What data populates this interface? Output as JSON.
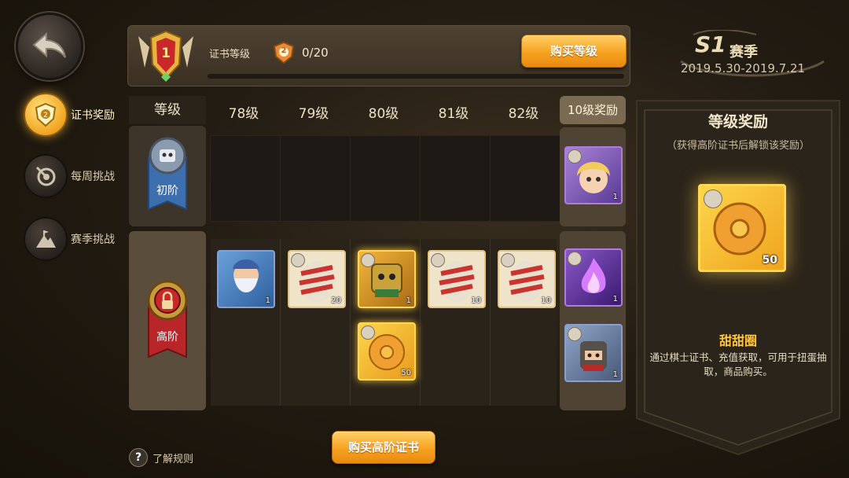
{
  "nav": {
    "items": [
      {
        "label": "证书奖励",
        "icon": "shield-cert-icon",
        "active": true
      },
      {
        "label": "每周挑战",
        "icon": "target-icon",
        "active": false
      },
      {
        "label": "赛季挑战",
        "icon": "mountain-flag-icon",
        "active": false
      }
    ]
  },
  "top": {
    "level_badge_number": "1",
    "cert_level_label": "证书等级",
    "xp_icon_number": "2",
    "xp": "0/20",
    "xp_progress": 0,
    "buy_level_label": "购买等级",
    "season_title": "S1",
    "season_suffix": "赛季",
    "season_dates": "2019.5.30-2019.7.21"
  },
  "grid": {
    "header_level": "等级",
    "levels": [
      "78级",
      "79级",
      "80级",
      "81级",
      "82级"
    ],
    "reward10_header": "10级奖励",
    "tiers": {
      "basic": "初阶",
      "advanced": "高阶"
    },
    "advanced_items": [
      {
        "col": 0,
        "icon": "dwarf-chess-piece-icon",
        "qty": "1",
        "frame": "blue"
      },
      {
        "col": 1,
        "icon": "striped-egg-icon",
        "qty": "20",
        "frame": "tan"
      },
      {
        "col": 2,
        "icon": "mech-chess-piece-icon",
        "qty": "1",
        "frame": "gold"
      },
      {
        "col": 3,
        "icon": "striped-egg-icon",
        "qty": "10",
        "frame": "tan"
      },
      {
        "col": 4,
        "icon": "striped-egg-icon",
        "qty": "10",
        "frame": "tan"
      },
      {
        "col": 2,
        "icon": "donut-icon",
        "qty": "50",
        "frame": "gold"
      }
    ],
    "reward10_basic": [
      {
        "icon": "blonde-hero-avatar-icon",
        "qty": "1",
        "frame": "purple"
      }
    ],
    "reward10_advanced": [
      {
        "icon": "purple-flame-icon",
        "qty": "1",
        "frame": "purple"
      },
      {
        "icon": "armored-knight-avatar-icon",
        "qty": "1",
        "frame": "blue"
      }
    ]
  },
  "panel": {
    "title": "等级奖励",
    "subtitle": "（获得高阶证书后解锁该奖励）",
    "item_icon": "donut-icon",
    "item_qty": "50",
    "item_name": "甜甜圈",
    "item_desc": "通过棋士证书、充值获取，可用于扭蛋抽取，商品购买。"
  },
  "footer": {
    "buy_advanced_label": "购买高阶证书",
    "help_label": "了解规则",
    "help_icon_glyph": "?"
  },
  "colors": {
    "accent_gold": "#f7a21f",
    "highlight_text": "#ffc63b",
    "panel_bg": "#2a2319"
  }
}
